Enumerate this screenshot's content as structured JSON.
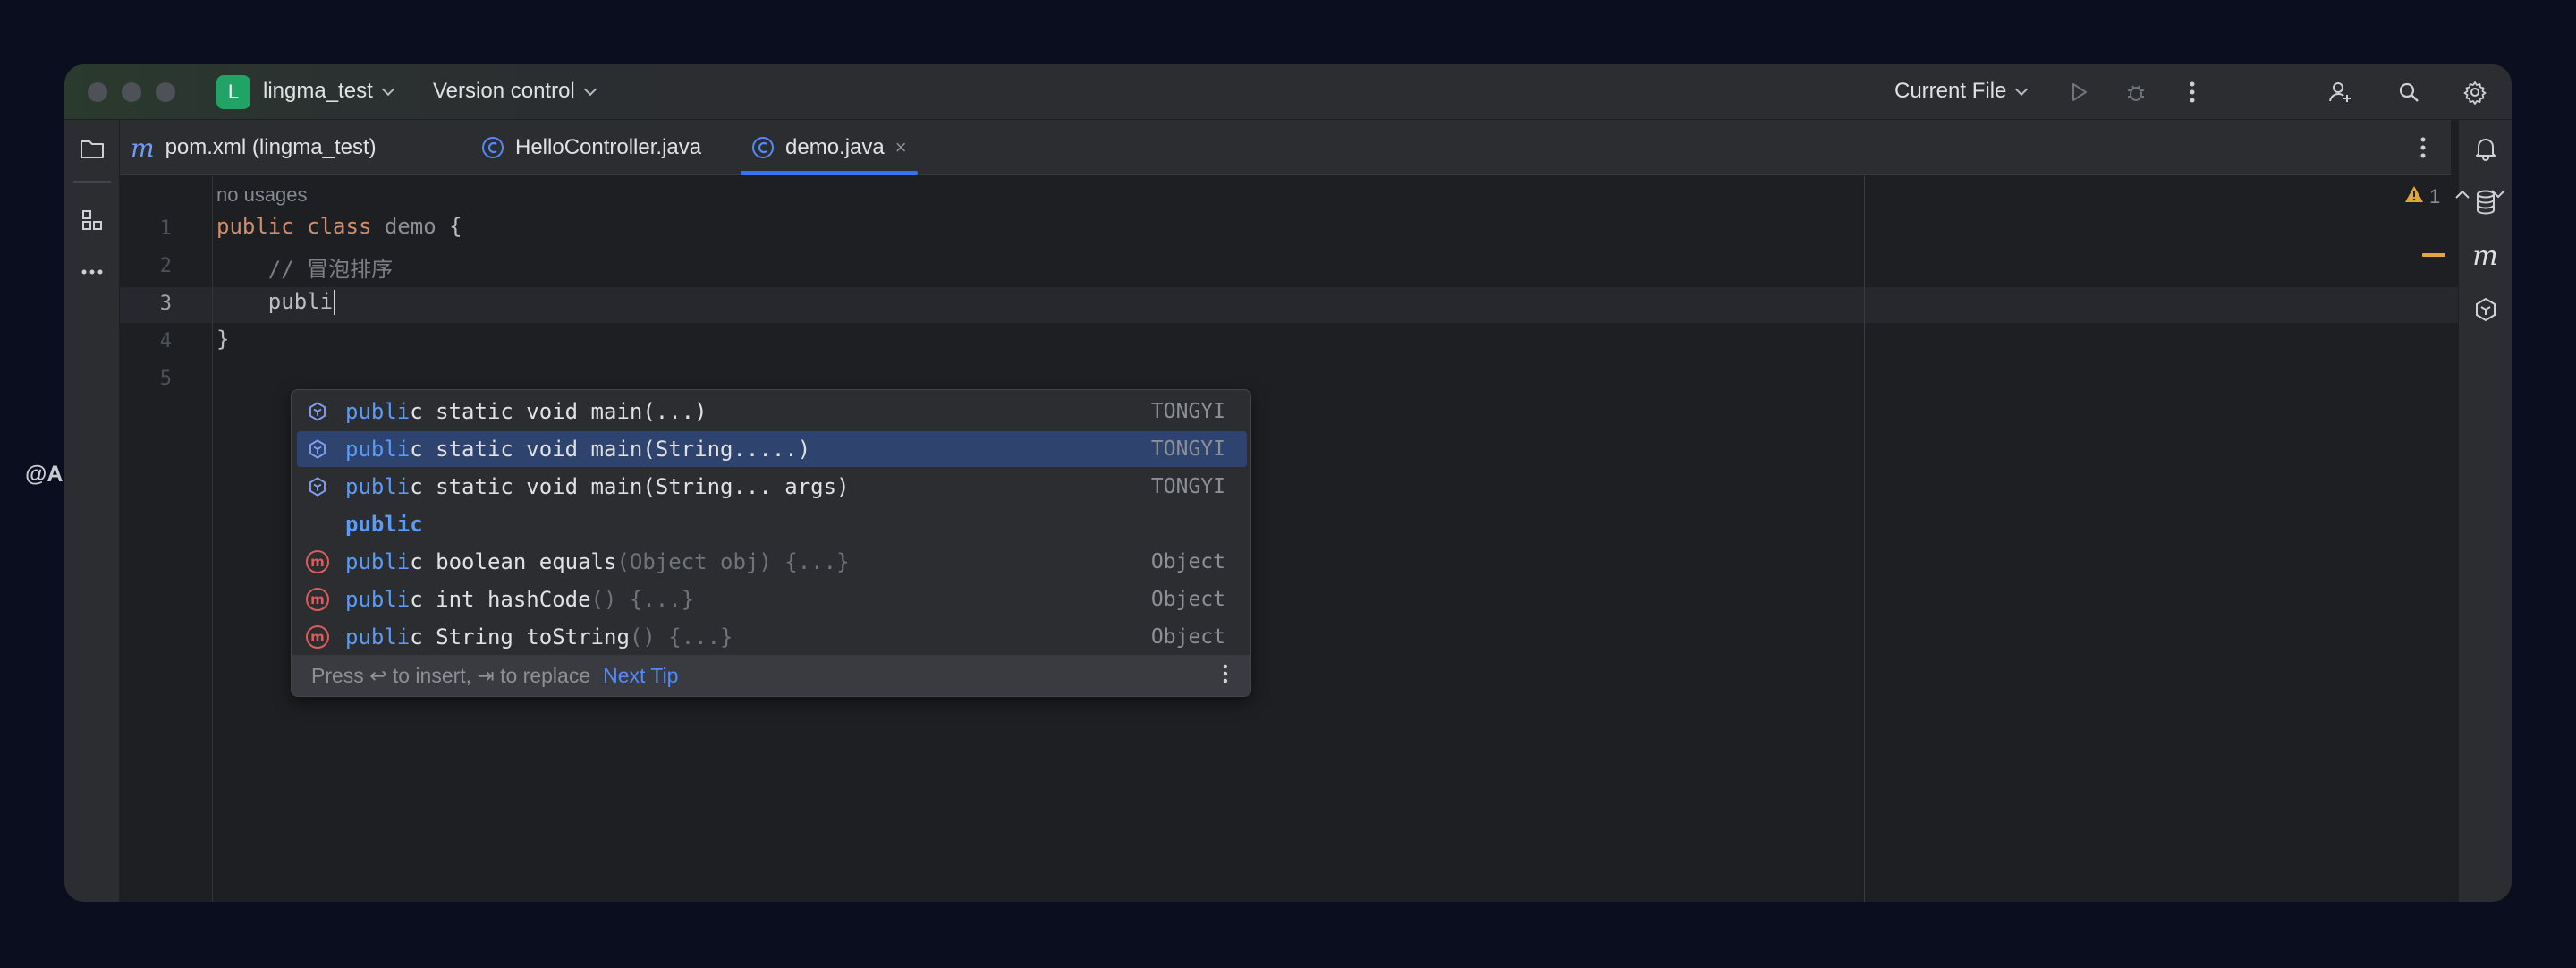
{
  "watermark": "@AIHub.cn",
  "titlebar": {
    "project_badge": "L",
    "project_name": "lingma_test",
    "vcs_label": "Version control",
    "run_config": "Current File"
  },
  "tabs": [
    {
      "label": "pom.xml (lingma_test)",
      "icon": "maven-icon",
      "active": false
    },
    {
      "label": "HelloController.java",
      "icon": "java-class-icon",
      "active": false
    },
    {
      "label": "demo.java",
      "icon": "java-class-icon",
      "active": true,
      "close": "×"
    }
  ],
  "editor": {
    "inlay_hint": "no usages",
    "line_numbers": [
      "1",
      "2",
      "3",
      "4",
      "5"
    ],
    "current_line": "3",
    "lines": {
      "l1_kw1": "public",
      "l1_kw2": "class",
      "l1_name": "demo",
      "l1_brace": "{",
      "l2_comment": "// 冒泡排序",
      "l3_text": "publi",
      "l4_text": "}"
    },
    "warnings_count": "1"
  },
  "completion": {
    "items": [
      {
        "match": "publi",
        "rest": "c static void main(...)",
        "tail": "",
        "source": "TONGYI",
        "icon": "tongyi-icon"
      },
      {
        "match": "publi",
        "rest": "c static void main(String.....)",
        "tail": "",
        "source": "TONGYI",
        "icon": "tongyi-icon",
        "selected": true
      },
      {
        "match": "publi",
        "rest": "c static void main(String... args)",
        "tail": "",
        "source": "TONGYI",
        "icon": "tongyi-icon"
      },
      {
        "match": "publi",
        "rest": "c",
        "tail": "",
        "source": "",
        "icon": ""
      },
      {
        "match": "publi",
        "rest": "c boolean equals",
        "tail": "(Object obj) {...}",
        "source": "Object",
        "icon": "method-icon"
      },
      {
        "match": "publi",
        "rest": "c int hashCode",
        "tail": "() {...}",
        "source": "Object",
        "icon": "method-icon"
      },
      {
        "match": "publi",
        "rest": "c String toString",
        "tail": "() {...}",
        "source": "Object",
        "icon": "method-icon"
      }
    ],
    "method_badge": "m",
    "footer_text": "Press ↩ to insert, ⇥ to replace",
    "footer_link": "Next Tip"
  },
  "colors": {
    "accent": "#3574f0",
    "selection": "#2e436e",
    "keyword": "#cf8e6d",
    "match_highlight": "#5b9bf5",
    "project_badge": "#21a366",
    "warning": "#e0a73a"
  }
}
